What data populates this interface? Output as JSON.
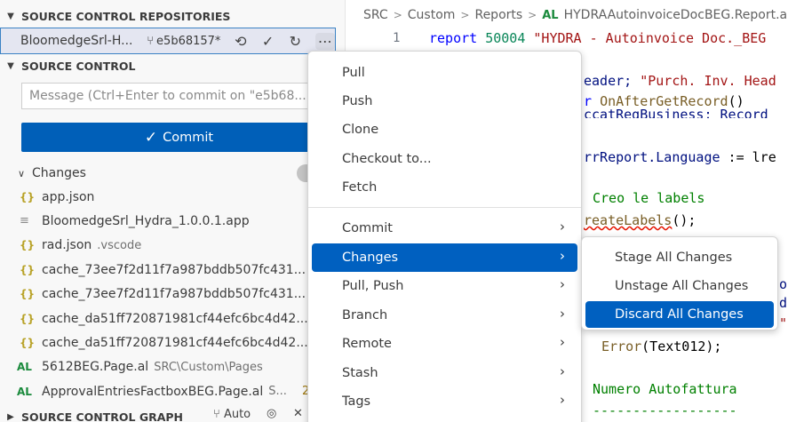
{
  "sidebar": {
    "repos_header": "SOURCE CONTROL REPOSITORIES",
    "repo": {
      "name": "BloomedgeSrl-H...",
      "branch": "e5b68157*"
    },
    "sc_header": "SOURCE CONTROL",
    "message": {
      "placeholder": "Message (Ctrl+Enter to commit on \"e5b68..."
    },
    "commit_label": "Commit",
    "changes_label": "Changes",
    "files": [
      {
        "icon": "{}",
        "kind": "json",
        "name": "app.json",
        "desc": "",
        "status": ""
      },
      {
        "icon": "≡",
        "kind": "app",
        "name": "BloomedgeSrl_Hydra_1.0.0.1.app",
        "desc": "",
        "status": ""
      },
      {
        "icon": "{}",
        "kind": "json",
        "name": "rad.json",
        "desc": ".vscode",
        "status": ""
      },
      {
        "icon": "{}",
        "kind": "json",
        "name": "cache_73ee7f2d11f7a987bddb507fc431...",
        "desc": "",
        "status": ""
      },
      {
        "icon": "{}",
        "kind": "json",
        "name": "cache_73ee7f2d11f7a987bddb507fc431...",
        "desc": "",
        "status": ""
      },
      {
        "icon": "{}",
        "kind": "json",
        "name": "cache_da51ff720871981cf44efc6bc4d42...",
        "desc": "",
        "status": ""
      },
      {
        "icon": "{}",
        "kind": "json",
        "name": "cache_da51ff720871981cf44efc6bc4d42...",
        "desc": "",
        "status": ""
      },
      {
        "icon": "AL",
        "kind": "al",
        "name": "5612BEG.Page.al",
        "desc": "SRC\\Custom\\Pages",
        "status": ""
      },
      {
        "icon": "AL",
        "kind": "al",
        "name": "ApprovalEntriesFactboxBEG.Page.al",
        "desc": "S...",
        "status": "2"
      }
    ],
    "graph_header": "SOURCE CONTROL GRAPH",
    "graph_auto": "Auto"
  },
  "editor": {
    "breadcrumb": [
      "SRC",
      "Custom",
      "Reports"
    ],
    "breadcrumb_file_icon": "AL",
    "breadcrumb_file": "HYDRAAutoinvoiceDocBEG.Report.a",
    "line_number": "1",
    "code": {
      "l1_kw": "report",
      "l1_rest": " 50004 ",
      "l1_str": "\"HYDRA - Autoinvoice Doc._BEG",
      "l2_a": "eader; ",
      "l2_str": "\"Purch. Inv. Head",
      "l3_kw": "r ",
      "l3_fn": "OnAfterGetRecord",
      "l3_rest": "()",
      "l4": "ccatRegBusiness: Record",
      "l5_a": "rrReport.",
      "l5_b": "Language",
      "l5_c": " := lre",
      "l6": "Creo le labels",
      "l7_fn": "reateLabels",
      "l7_rest": "();",
      "l8": "o",
      "l9": "d",
      "l10": "\"",
      "l11_fn": "Error",
      "l11_rest": "(Text012);",
      "l12": "Numero Autofattura",
      "l13": "------------------"
    }
  },
  "menu": {
    "items": [
      {
        "label": "Pull",
        "submenu": false
      },
      {
        "label": "Push",
        "submenu": false
      },
      {
        "label": "Clone",
        "submenu": false
      },
      {
        "label": "Checkout to...",
        "submenu": false
      },
      {
        "label": "Fetch",
        "submenu": false
      },
      {
        "label": "Commit",
        "submenu": true
      },
      {
        "label": "Changes",
        "submenu": true
      },
      {
        "label": "Pull, Push",
        "submenu": true
      },
      {
        "label": "Branch",
        "submenu": true
      },
      {
        "label": "Remote",
        "submenu": true
      },
      {
        "label": "Stash",
        "submenu": true
      },
      {
        "label": "Tags",
        "submenu": true
      }
    ],
    "submenu_items": [
      "Stage All Changes",
      "Unstage All Changes",
      "Discard All Changes"
    ]
  },
  "colors": {
    "accent": "#005fb8",
    "menu_highlight": "#0060c0",
    "sidebar_bg": "#f8f8f8"
  }
}
